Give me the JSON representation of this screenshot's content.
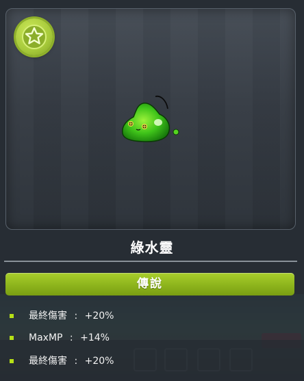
{
  "pet": {
    "name": "綠水靈",
    "rank": "傳說",
    "rank_color": "#8db41c",
    "badge_icon": "star-icon"
  },
  "stats": [
    {
      "label": "最終傷害",
      "sep": ":",
      "value": "+20%"
    },
    {
      "label": "MaxMP",
      "sep": ":",
      "value": "+14%"
    },
    {
      "label": "最終傷害",
      "sep": ":",
      "value": "+20%"
    }
  ]
}
